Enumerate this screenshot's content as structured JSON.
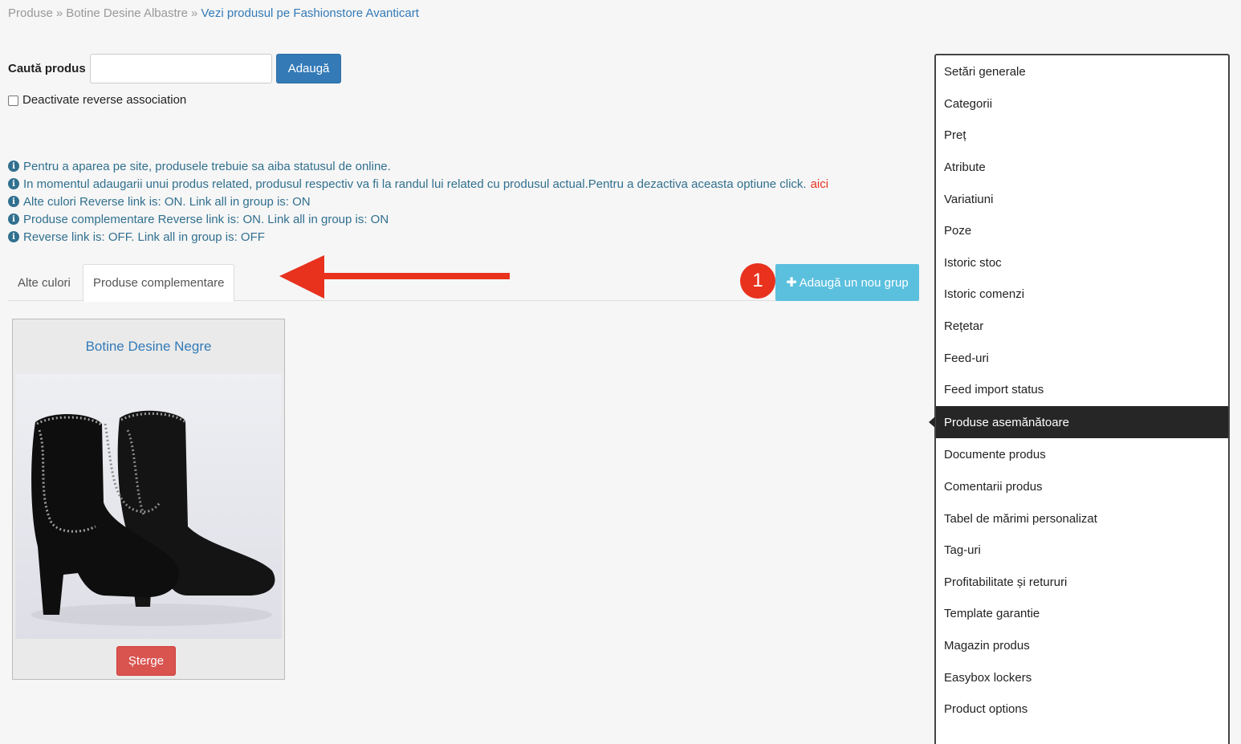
{
  "breadcrumb": {
    "items": [
      "Produse",
      "Botine Desine Albastre"
    ],
    "separator": "»",
    "link": "Vezi produsul pe Fashionstore Avanticart"
  },
  "search": {
    "label": "Caută produs",
    "value": "",
    "placeholder": "",
    "add_button": "Adaugă"
  },
  "reverse_checkbox": {
    "label": "Deactivate reverse association",
    "checked": false
  },
  "info": {
    "line1": "Pentru a aparea pe site, produsele trebuie sa aiba statusul de online.",
    "line2": "In momentul adaugarii unui produs related, produsul respectiv va fi la randul lui related cu produsul actual.Pentru a dezactiva aceasta optiune click.",
    "line2_link": "aici",
    "line3": "Alte culori Reverse link is: ON. Link all in group is: ON",
    "line4": "Produse complementare Reverse link is: ON. Link all in group is: ON",
    "line5": "Reverse link is: OFF. Link all in group is: OFF",
    "icon": "info-circle-icon"
  },
  "tabs": {
    "alte": "Alte culori",
    "compl": "Produse complementare",
    "active": "Produse complementare"
  },
  "new_group_button": "Adaugă un nou grup",
  "callout_number": "1",
  "product": {
    "title": "Botine Desine Negre",
    "delete_button": "Șterge"
  },
  "menu": {
    "items": [
      "Setări generale",
      "Categorii",
      "Preț",
      "Atribute",
      "Variatiuni",
      "Poze",
      "Istoric stoc",
      "Istoric comenzi",
      "Rețetar",
      "Feed-uri",
      "Feed import status",
      "Produse asemănătoare",
      "Documente produs",
      "Comentarii produs",
      "Tabel de mărimi personalizat",
      "Tag-uri",
      "Profitabilitate și retururi",
      "Template garantie",
      "Magazin produs",
      "Easybox lockers",
      "Product options"
    ],
    "active": "Produse asemănătoare"
  },
  "colors": {
    "primary": "#337ab7",
    "info": "#5bc0de",
    "danger": "#d9534f",
    "callout": "#e8321e",
    "menu_active": "#262626"
  }
}
